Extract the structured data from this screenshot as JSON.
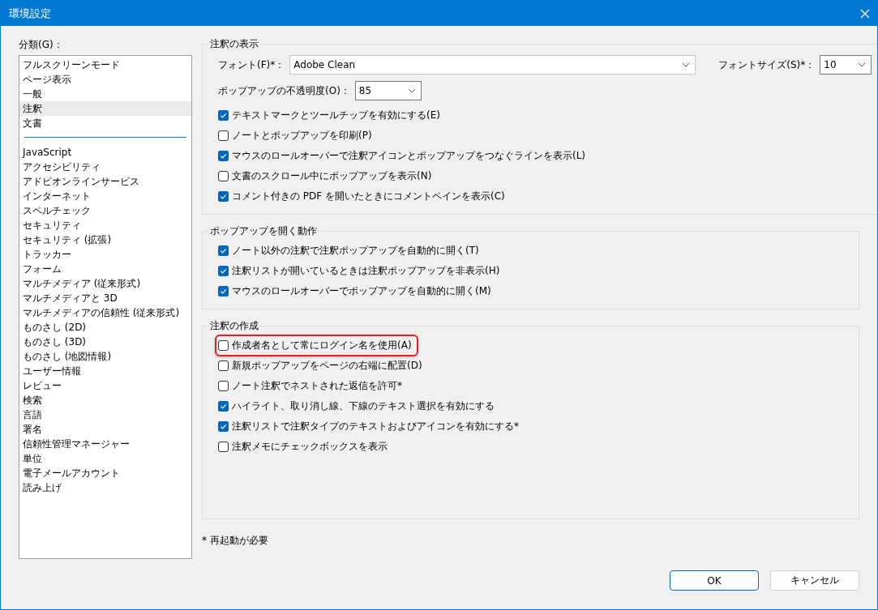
{
  "window": {
    "title": "環境設定"
  },
  "sidebar": {
    "label": "分類(G)：",
    "groups": [
      {
        "items": [
          {
            "label": "フルスクリーンモード",
            "selected": false
          },
          {
            "label": "ページ表示",
            "selected": false
          },
          {
            "label": "一般",
            "selected": false
          },
          {
            "label": "注釈",
            "selected": true
          },
          {
            "label": "文書",
            "selected": false
          }
        ]
      },
      {
        "items": [
          {
            "label": "JavaScript",
            "selected": false
          },
          {
            "label": "アクセシビリティ",
            "selected": false
          },
          {
            "label": "アドビオンラインサービス",
            "selected": false
          },
          {
            "label": "インターネット",
            "selected": false
          },
          {
            "label": "スペルチェック",
            "selected": false
          },
          {
            "label": "セキュリティ",
            "selected": false
          },
          {
            "label": "セキュリティ (拡張)",
            "selected": false
          },
          {
            "label": "トラッカー",
            "selected": false
          },
          {
            "label": "フォーム",
            "selected": false
          },
          {
            "label": "マルチメディア (従来形式)",
            "selected": false
          },
          {
            "label": "マルチメディアと 3D",
            "selected": false
          },
          {
            "label": "マルチメディアの信頼性 (従来形式)",
            "selected": false
          },
          {
            "label": "ものさし (2D)",
            "selected": false
          },
          {
            "label": "ものさし (3D)",
            "selected": false
          },
          {
            "label": "ものさし (地図情報)",
            "selected": false
          },
          {
            "label": "ユーザー情報",
            "selected": false
          },
          {
            "label": "レビュー",
            "selected": false
          },
          {
            "label": "検索",
            "selected": false
          },
          {
            "label": "言語",
            "selected": false
          },
          {
            "label": "署名",
            "selected": false
          },
          {
            "label": "信頼性管理マネージャー",
            "selected": false
          },
          {
            "label": "単位",
            "selected": false
          },
          {
            "label": "電子メールアカウント",
            "selected": false
          },
          {
            "label": "読み上げ",
            "selected": false
          }
        ]
      }
    ]
  },
  "sections": [
    {
      "title": "注釈の表示",
      "field_rows": [
        [
          {
            "label": "フォント(F)*：",
            "value": "Adobe Clean",
            "kind": "wide"
          },
          {
            "label": "フォントサイズ(S)*：",
            "value": "10",
            "kind": "small"
          }
        ],
        [
          {
            "label": "ポップアップの不透明度(O)：",
            "value": "85",
            "kind": "medium"
          }
        ]
      ],
      "checkboxes": [
        {
          "label": "テキストマークとツールチップを有効にする(E)",
          "checked": true,
          "highlighted": false
        },
        {
          "label": "ノートとポップアップを印刷(P)",
          "checked": false,
          "highlighted": false
        },
        {
          "label": "マウスのロールオーバーで注釈アイコンとポップアップをつなぐラインを表示(L)",
          "checked": true,
          "highlighted": false
        },
        {
          "label": "文書のスクロール中にポップアップを表示(N)",
          "checked": false,
          "highlighted": false
        },
        {
          "label": "コメント付きの PDF を開いたときにコメントペインを表示(C)",
          "checked": true,
          "highlighted": false
        }
      ]
    },
    {
      "title": "ポップアップを開く動作",
      "checkboxes": [
        {
          "label": "ノート以外の注釈で注釈ポップアップを自動的に開く(T)",
          "checked": true,
          "highlighted": false
        },
        {
          "label": "注釈リストが開いているときは注釈ポップアップを非表示(H)",
          "checked": true,
          "highlighted": false
        },
        {
          "label": "マウスのロールオーバーでポップアップを自動的に開く(M)",
          "checked": true,
          "highlighted": false
        }
      ]
    },
    {
      "title": "注釈の作成",
      "checkboxes": [
        {
          "label": "作成者名として常にログイン名を使用(A)",
          "checked": false,
          "highlighted": true
        },
        {
          "label": "新規ポップアップをページの右端に配置(D)",
          "checked": false,
          "highlighted": false
        },
        {
          "label": "ノート注釈でネストされた返信を許可*",
          "checked": false,
          "highlighted": false
        },
        {
          "label": "ハイライト、取り消し線、下線のテキスト選択を有効にする",
          "checked": true,
          "highlighted": false
        },
        {
          "label": "注釈リストで注釈タイプのテキストおよびアイコンを有効にする*",
          "checked": true,
          "highlighted": false
        },
        {
          "label": "注釈メモにチェックボックスを表示",
          "checked": false,
          "highlighted": false
        }
      ]
    }
  ],
  "note": "* 再起動が必要",
  "buttons": [
    {
      "label": "OK",
      "default": true
    },
    {
      "label": "キャンセル",
      "default": false
    }
  ]
}
